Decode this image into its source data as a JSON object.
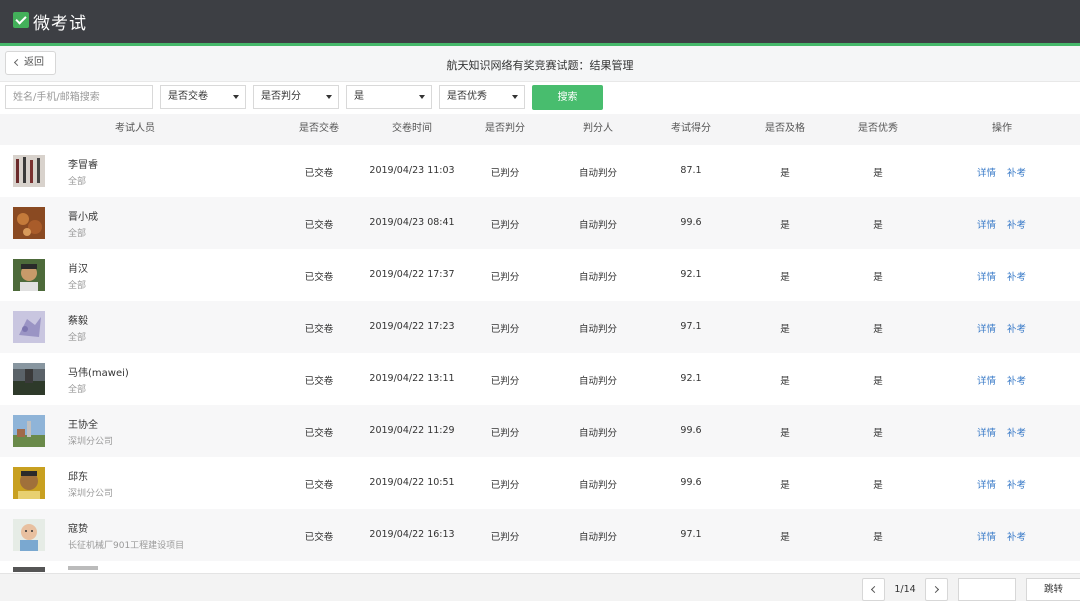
{
  "app": {
    "title": "微考试",
    "accent": "#45b86a",
    "header_bg": "#3d3f44",
    "logo_icon": "checkbox-icon"
  },
  "subheader": {
    "back_label": "返回",
    "title": "航天知识网络有奖竞赛试题：结果管理"
  },
  "filters": {
    "search_placeholder": "姓名/手机/邮箱搜索",
    "submitted_select": "是否交卷",
    "graded_select": "是否判分",
    "pass_select": "是",
    "excellent_select": "是否优秀",
    "search_button": "搜索"
  },
  "table": {
    "headers": [
      "考试人员",
      "是否交卷",
      "交卷时间",
      "是否判分",
      "判分人",
      "考试得分",
      "是否及格",
      "是否优秀",
      "操作"
    ],
    "rows": [
      {
        "name": "李冒睿",
        "dept": "全部",
        "submitted": "已交卷",
        "time": "2019/04/23 11:03",
        "graded": "已判分",
        "grader": "自动判分",
        "score": "87.1",
        "passed": "是",
        "excellent": "是",
        "detail": "详情",
        "retake": "补考"
      },
      {
        "name": "晋小成",
        "dept": "全部",
        "submitted": "已交卷",
        "time": "2019/04/23 08:41",
        "graded": "已判分",
        "grader": "自动判分",
        "score": "99.6",
        "passed": "是",
        "excellent": "是",
        "detail": "详情",
        "retake": "补考"
      },
      {
        "name": "肖汉",
        "dept": "全部",
        "submitted": "已交卷",
        "time": "2019/04/22 17:37",
        "graded": "已判分",
        "grader": "自动判分",
        "score": "92.1",
        "passed": "是",
        "excellent": "是",
        "detail": "详情",
        "retake": "补考"
      },
      {
        "name": "蔡毅",
        "dept": "全部",
        "submitted": "已交卷",
        "time": "2019/04/22 17:23",
        "graded": "已判分",
        "grader": "自动判分",
        "score": "97.1",
        "passed": "是",
        "excellent": "是",
        "detail": "详情",
        "retake": "补考"
      },
      {
        "name": "马伟(mawei)",
        "dept": "全部",
        "submitted": "已交卷",
        "time": "2019/04/22 13:11",
        "graded": "已判分",
        "grader": "自动判分",
        "score": "92.1",
        "passed": "是",
        "excellent": "是",
        "detail": "详情",
        "retake": "补考"
      },
      {
        "name": "王协全",
        "dept": "深圳分公司",
        "submitted": "已交卷",
        "time": "2019/04/22 11:29",
        "graded": "已判分",
        "grader": "自动判分",
        "score": "99.6",
        "passed": "是",
        "excellent": "是",
        "detail": "详情",
        "retake": "补考"
      },
      {
        "name": "邱东",
        "dept": "深圳分公司",
        "submitted": "已交卷",
        "time": "2019/04/22 10:51",
        "graded": "已判分",
        "grader": "自动判分",
        "score": "99.6",
        "passed": "是",
        "excellent": "是",
        "detail": "详情",
        "retake": "补考"
      },
      {
        "name": "寇贽",
        "dept": "长征机械厂901工程建设项目",
        "submitted": "已交卷",
        "time": "2019/04/22 16:13",
        "graded": "已判分",
        "grader": "自动判分",
        "score": "97.1",
        "passed": "是",
        "excellent": "是",
        "detail": "详情",
        "retake": "补考"
      }
    ]
  },
  "pagination": {
    "page_text": "1/14",
    "go_label": "跳转"
  }
}
